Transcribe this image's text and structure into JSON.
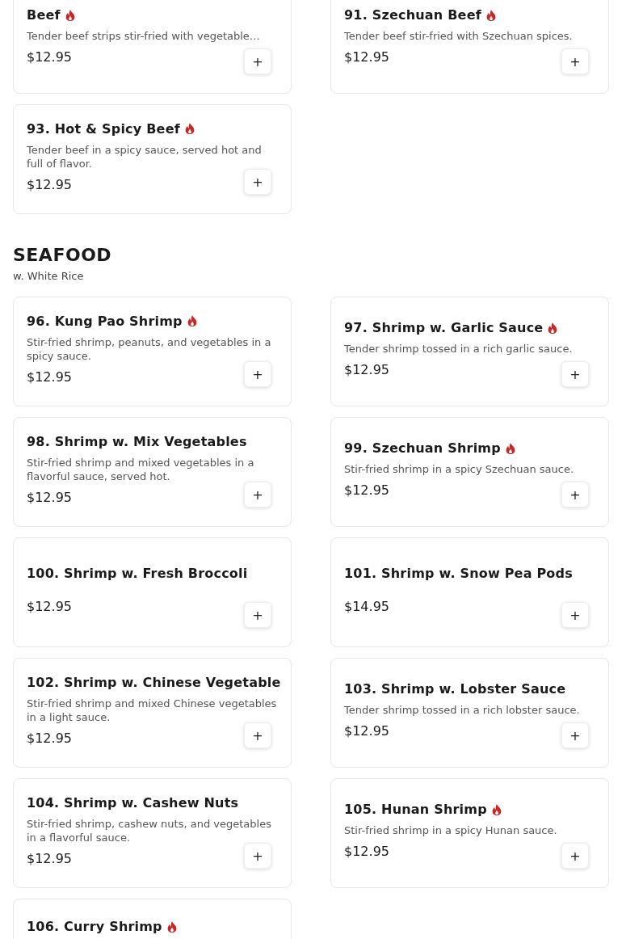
{
  "sections": [
    {
      "items": [
        {
          "name": "Beef",
          "description": "Tender beef strips stir-fried with vegetable…",
          "price": "$12.95",
          "spicy": true,
          "add": "+"
        },
        {
          "name": "91. Szechuan Beef",
          "description": "Tender beef stir-fried with Szechuan spices.",
          "price": "$12.95",
          "spicy": true,
          "add": "+"
        },
        {
          "name": "93. Hot & Spicy Beef",
          "description": "Tender beef in a spicy sauce, served hot and full of flavor.",
          "price": "$12.95",
          "spicy": true,
          "add": "+"
        }
      ]
    },
    {
      "title": "SEAFOOD",
      "subtitle": "w. White Rice",
      "items": [
        {
          "name": "96. Kung Pao Shrimp",
          "description": "Stir-fried shrimp, peanuts, and vegetables in a spicy sauce.",
          "price": "$12.95",
          "spicy": true,
          "add": "+"
        },
        {
          "name": "97. Shrimp w. Garlic Sauce",
          "description": "Tender shrimp tossed in a rich garlic sauce.",
          "price": "$12.95",
          "spicy": true,
          "add": "+"
        },
        {
          "name": "98. Shrimp w. Mix Vegetables",
          "description": "Stir-fried shrimp and mixed vegetables in a flavorful sauce, served hot.",
          "price": "$12.95",
          "spicy": false,
          "add": "+"
        },
        {
          "name": "99. Szechuan Shrimp",
          "description": "Stir-fried shrimp in a spicy Szechuan sauce.",
          "price": "$12.95",
          "spicy": true,
          "add": "+"
        },
        {
          "name": "100. Shrimp w. Fresh Broccoli",
          "price": "$12.95",
          "spicy": false,
          "add": "+"
        },
        {
          "name": "101. Shrimp w. Snow Pea Pods",
          "price": "$14.95",
          "spicy": false,
          "add": "+"
        },
        {
          "name": "102. Shrimp w. Chinese Vegetable",
          "description": "Stir-fried shrimp and mixed Chinese vegetables in a light sauce.",
          "price": "$12.95",
          "spicy": false,
          "add": "+"
        },
        {
          "name": "103. Shrimp w. Lobster Sauce",
          "description": "Tender shrimp tossed in a rich lobster sauce.",
          "price": "$12.95",
          "spicy": false,
          "add": "+"
        },
        {
          "name": "104. Shrimp w. Cashew Nuts",
          "description": "Stir-fried shrimp, cashew nuts, and vegetables in a flavorful sauce.",
          "price": "$12.95",
          "spicy": false,
          "add": "+"
        },
        {
          "name": "105. Hunan Shrimp",
          "description": "Stir-fried shrimp in a spicy Hunan sauce.",
          "price": "$12.95",
          "spicy": true,
          "add": "+"
        },
        {
          "name": "106. Curry Shrimp",
          "spicy": true
        }
      ]
    }
  ]
}
